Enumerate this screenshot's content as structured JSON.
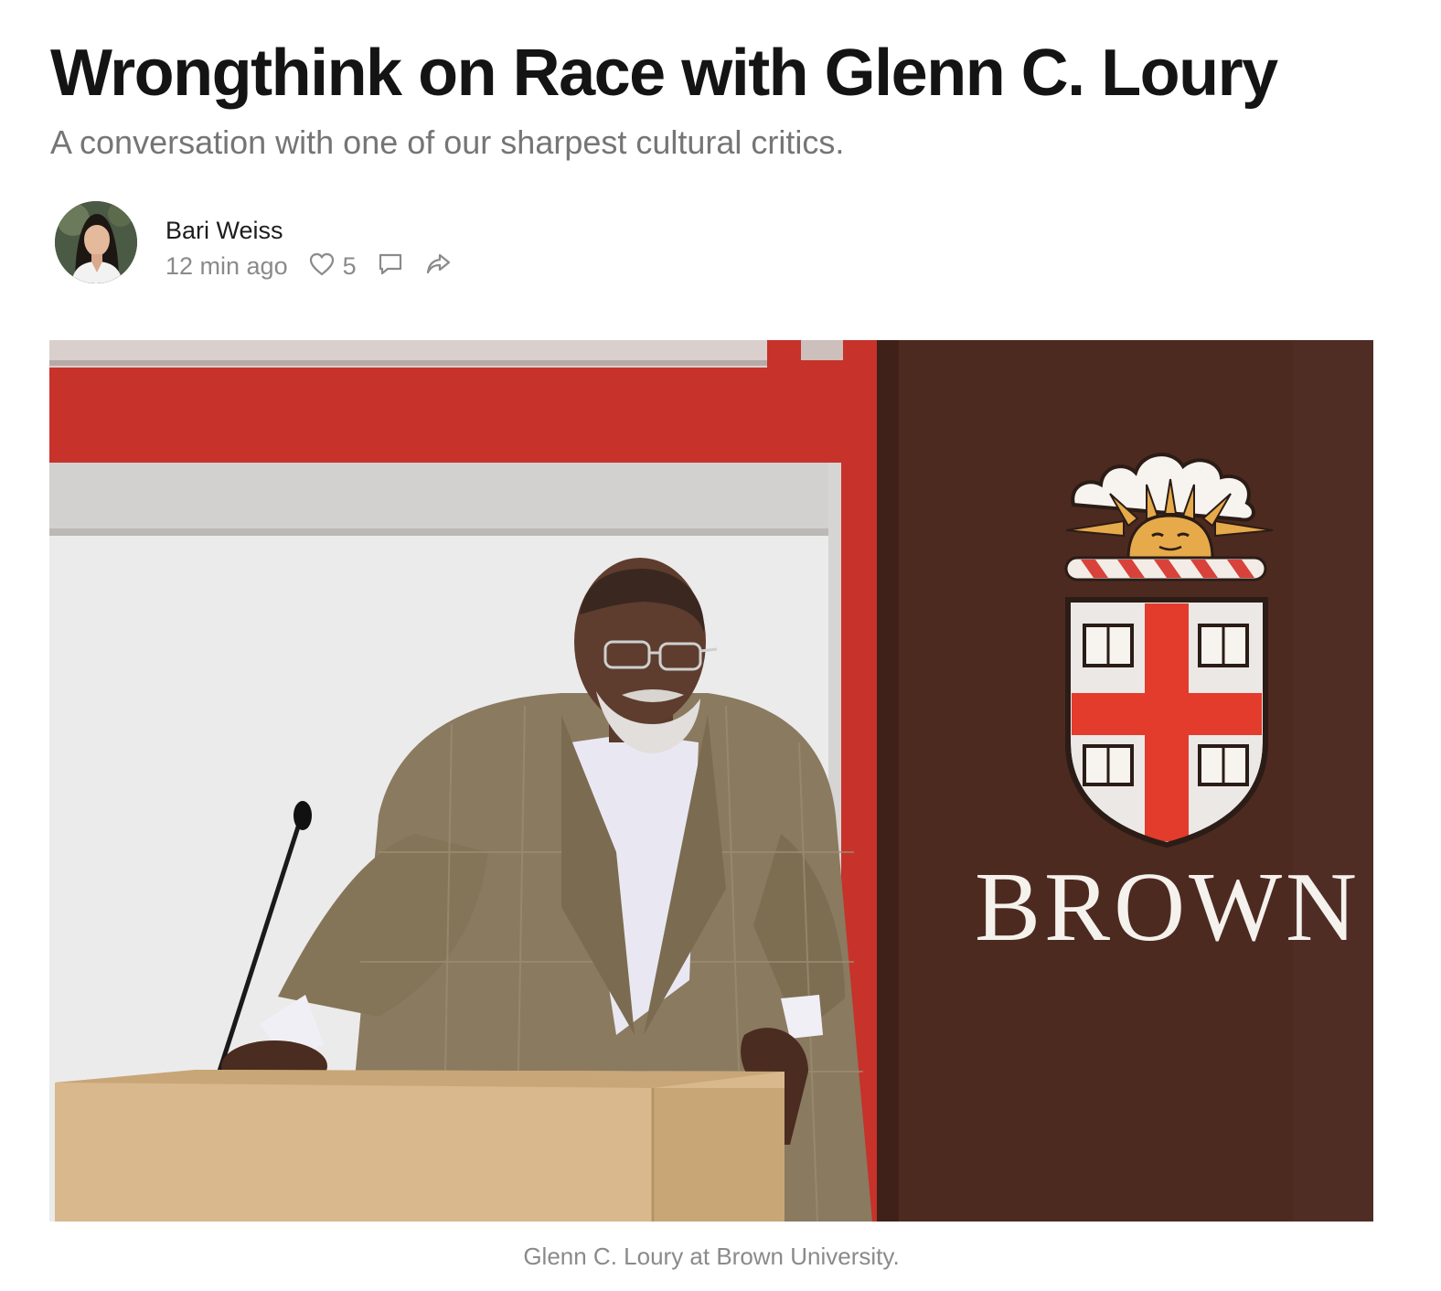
{
  "post": {
    "title": "Wrongthink on Race with Glenn C. Loury",
    "subtitle": "A conversation with one of our sharpest cultural critics."
  },
  "byline": {
    "author": "Bari Weiss",
    "timestamp": "12 min ago",
    "like_count": "5",
    "icons": {
      "like": "heart-icon",
      "comment": "comment-icon",
      "share": "share-icon"
    }
  },
  "hero": {
    "banner_text": "BROWN",
    "caption": "Glenn C. Loury at Brown University."
  },
  "colors": {
    "title": "#141414",
    "muted": "#8a8a8a",
    "wall_red": "#c7322b",
    "banner_brown": "#4d2a20",
    "shield_red": "#e33b2c"
  }
}
